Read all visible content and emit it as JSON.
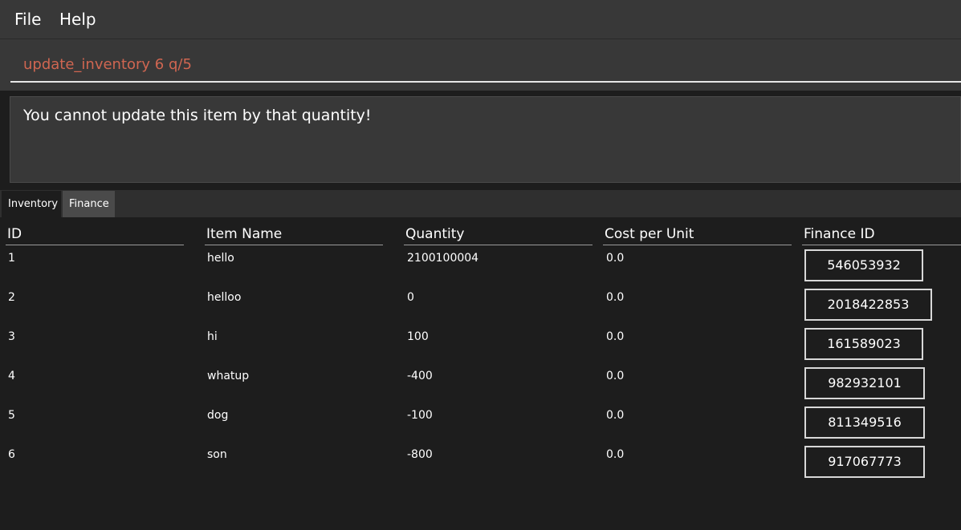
{
  "menu": {
    "file_label": "File",
    "help_label": "Help"
  },
  "command": {
    "value": "update_inventory 6 q/5"
  },
  "result": {
    "message": "You cannot update this item by that quantity!"
  },
  "tabs": {
    "inventory_label": "Inventory",
    "finance_label": "Finance",
    "selected": "Inventory"
  },
  "table": {
    "headers": {
      "id": "ID",
      "item_name": "Item Name",
      "quantity": "Quantity",
      "cost_per_unit": "Cost per Unit",
      "finance_id": "Finance ID"
    },
    "rows": [
      {
        "id": "1",
        "item_name": "hello",
        "quantity": "2100100004",
        "cost": "0.0",
        "finance_id": "546053932"
      },
      {
        "id": "2",
        "item_name": "helloo",
        "quantity": "0",
        "cost": "0.0",
        "finance_id": "2018422853"
      },
      {
        "id": "3",
        "item_name": "hi",
        "quantity": "100",
        "cost": "0.0",
        "finance_id": "161589023"
      },
      {
        "id": "4",
        "item_name": "whatup",
        "quantity": "-400",
        "cost": "0.0",
        "finance_id": "982932101"
      },
      {
        "id": "5",
        "item_name": "dog",
        "quantity": "-100",
        "cost": "0.0",
        "finance_id": "811349516"
      },
      {
        "id": "6",
        "item_name": "son",
        "quantity": "-800",
        "cost": "0.0",
        "finance_id": "917067773"
      }
    ]
  },
  "colors": {
    "command_text": "#d06651",
    "background": "#1d1d1d",
    "panel": "#383838"
  }
}
